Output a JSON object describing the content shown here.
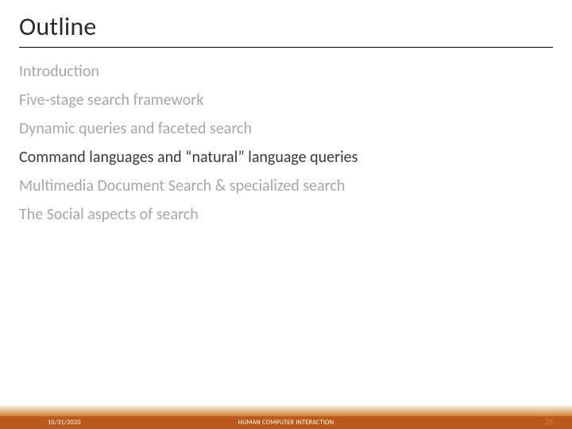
{
  "title": "Outline",
  "items": [
    {
      "text": "Introduction",
      "dim": true
    },
    {
      "text": "Five-stage search framework",
      "dim": true
    },
    {
      "text": "Dynamic queries and faceted search",
      "dim": true
    },
    {
      "text": "Command languages and “natural” language queries",
      "dim": false
    },
    {
      "text": "Multimedia Document Search & specialized search",
      "dim": true
    },
    {
      "text": "The Social aspects of search",
      "dim": true
    }
  ],
  "footer": {
    "date": "10/31/2020",
    "center": "HUMAN COMPUTER INTERACTION",
    "page": "36"
  }
}
